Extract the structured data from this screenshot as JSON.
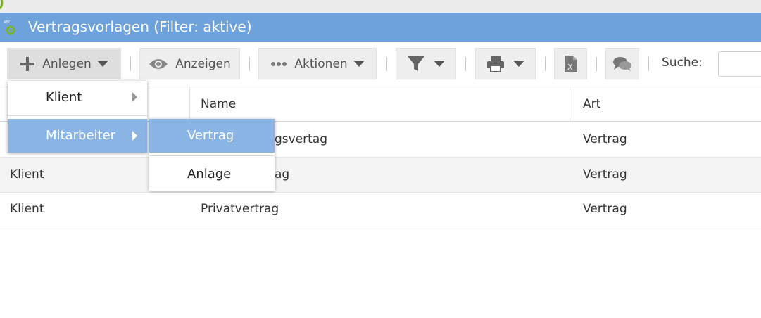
{
  "top_fragment": ")",
  "title": "Vertragsvorlagen (Filter: aktive)",
  "toolbar": {
    "create_label": "Anlegen",
    "view_label": "Anzeigen",
    "actions_label": "Aktionen",
    "search_label": "Suche:",
    "search_value": ""
  },
  "columns": [
    "",
    "Name",
    "Art"
  ],
  "rows": [
    {
      "owner": "",
      "name": "Arbeitsvertrag",
      "type": "Vertrag"
    },
    {
      "owner": "Klient",
      "name": "Dienstvertrag",
      "type": "Vertrag"
    },
    {
      "owner": "Klient",
      "name": "Privatvertrag",
      "type": "Vertrag"
    }
  ],
  "visible_name_fragments": [
    "gsvertag",
    "ag"
  ],
  "menu": {
    "items": [
      "Klient",
      "Mitarbeiter"
    ],
    "submenu": [
      "Vertrag",
      "Anlage"
    ]
  },
  "colors": {
    "title_bar": "#6da2dc",
    "highlight": "#8ab4e3",
    "accent_green": "#78b51e"
  }
}
